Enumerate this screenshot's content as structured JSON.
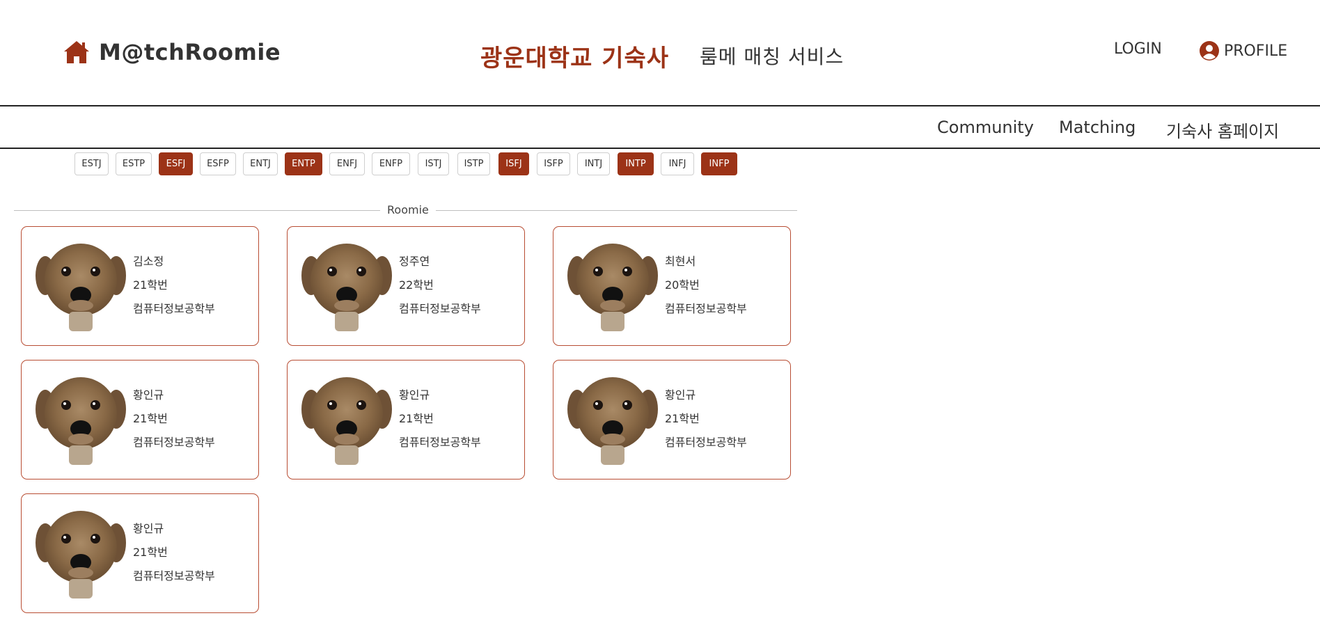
{
  "header": {
    "logo_text": "M@tchRoomie",
    "title_main": "광운대학교 기숙사",
    "title_sub": "룸메 매칭 서비스",
    "login_label": "LOGIN",
    "profile_label": "PROFILE",
    "icons": {
      "logo": "home-icon",
      "profile": "user-circle-icon"
    }
  },
  "nav": {
    "items": [
      {
        "label": "Community"
      },
      {
        "label": "Matching"
      },
      {
        "label": "기숙사 홈페이지"
      }
    ]
  },
  "mbti_filter": {
    "options": [
      {
        "label": "ESTJ",
        "selected": false
      },
      {
        "label": "ESTP",
        "selected": false
      },
      {
        "label": "ESFJ",
        "selected": true
      },
      {
        "label": "ESFP",
        "selected": false
      },
      {
        "label": "ENTJ",
        "selected": false
      },
      {
        "label": "ENTP",
        "selected": true
      },
      {
        "label": "ENFJ",
        "selected": false
      },
      {
        "label": "ENFP",
        "selected": false
      },
      {
        "label": "ISTJ",
        "selected": false
      },
      {
        "label": "ISTP",
        "selected": false
      },
      {
        "label": "ISFJ",
        "selected": true
      },
      {
        "label": "ISFP",
        "selected": false
      },
      {
        "label": "INTJ",
        "selected": false
      },
      {
        "label": "INTP",
        "selected": true
      },
      {
        "label": "INFJ",
        "selected": false
      },
      {
        "label": "INFP",
        "selected": true
      }
    ]
  },
  "section": {
    "label": "Roomie"
  },
  "roomies": [
    {
      "name": "김소정",
      "year": "21학번",
      "dept": "컴퓨터정보공학부"
    },
    {
      "name": "정주연",
      "year": "22학번",
      "dept": "컴퓨터정보공학부"
    },
    {
      "name": "최현서",
      "year": "20학번",
      "dept": "컴퓨터정보공학부"
    },
    {
      "name": "황인규",
      "year": "21학번",
      "dept": "컴퓨터정보공학부"
    },
    {
      "name": "황인규",
      "year": "21학번",
      "dept": "컴퓨터정보공학부"
    },
    {
      "name": "황인규",
      "year": "21학번",
      "dept": "컴퓨터정보공학부"
    },
    {
      "name": "황인규",
      "year": "21학번",
      "dept": "컴퓨터정보공학부"
    }
  ],
  "colors": {
    "accent": "#9c3317",
    "card_border": "#b84d33",
    "text": "#333333"
  }
}
